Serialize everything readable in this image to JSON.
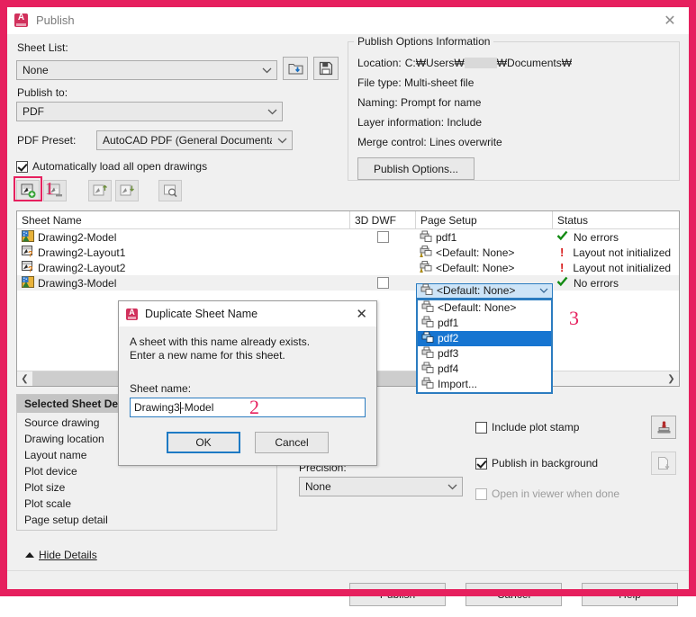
{
  "window": {
    "title": "Publish",
    "logo_text": "A",
    "close_icon": "✕"
  },
  "left": {
    "sheet_list_label": "Sheet List:",
    "sheet_list_value": "None",
    "publish_to_label": "Publish to:",
    "publish_to_value": "PDF",
    "pdf_preset_label": "PDF Preset:",
    "pdf_preset_value": "AutoCAD PDF (General Documentation)",
    "auto_load_label": "Automatically load all open drawings",
    "auto_load_checked": true
  },
  "toolbar": {
    "buttons": [
      "add-sheets-button",
      "remove-sheets-button",
      "move-sheet-up-button",
      "move-sheet-down-button",
      "preview-button"
    ]
  },
  "annotations": {
    "marker1": "1",
    "marker2": "2",
    "marker3": "3",
    "color": "#e6205e"
  },
  "options_info": {
    "legend": "Publish Options Information",
    "location_label": "Location:",
    "location_prefix": "C:₩Users₩",
    "location_suffix": "₩Documents₩",
    "file_type": "File type: Multi-sheet file",
    "naming": "Naming: Prompt for name",
    "layer_information": "Layer information: Include",
    "merge_control": "Merge control: Lines overwrite",
    "publish_options_button": "Publish Options..."
  },
  "sheet_table": {
    "columns": [
      "Sheet Name",
      "3D DWF",
      "Page Setup",
      "Status"
    ],
    "rows": [
      {
        "name": "Drawing2-Model",
        "icon": "model-sheet-icon",
        "dwf": true,
        "page_setup": "pdf1",
        "status": "No errors",
        "status_icon": "check-icon",
        "selected": false
      },
      {
        "name": "Drawing2-Layout1",
        "icon": "layout-sheet-icon",
        "dwf": false,
        "page_setup": "<Default: None>",
        "status": "Layout not initialized",
        "status_icon": "warning-icon",
        "selected": false
      },
      {
        "name": "Drawing2-Layout2",
        "icon": "layout-sheet-icon",
        "dwf": false,
        "page_setup": "<Default: None>",
        "status": "Layout not initialized",
        "status_icon": "warning-icon",
        "selected": false
      },
      {
        "name": "Drawing3-Model",
        "icon": "model-sheet-icon",
        "dwf": true,
        "page_setup": "<Default: None>",
        "status": "No errors",
        "status_icon": "check-icon",
        "selected": true
      }
    ],
    "page_setup_dropdown": {
      "open": true,
      "selected_value": "<Default: None>",
      "highlighted": "pdf2",
      "options": [
        "<Default: None>",
        "pdf1",
        "pdf2",
        "pdf3",
        "pdf4",
        "Import..."
      ]
    },
    "scroll_left_icon": "❮",
    "scroll_right_icon": "❯"
  },
  "details": {
    "header": "Selected Sheet Det",
    "items": [
      "Source drawing",
      "Drawing location",
      "Layout name",
      "Plot device",
      "Plot size",
      "Plot scale",
      "Page setup detail"
    ]
  },
  "middle": {
    "precision_label": "Precision:",
    "precision_value": "None",
    "copies_value": ""
  },
  "right_options": {
    "include_plot_stamp": {
      "label": "Include plot stamp",
      "checked": false,
      "icon": "plot-stamp-icon"
    },
    "publish_in_background": {
      "label": "Publish in background",
      "checked": true,
      "icon": "background-publish-icon"
    },
    "open_in_viewer": {
      "label": "Open in viewer when done",
      "checked": false,
      "disabled": true
    }
  },
  "footer": {
    "hide_details": "Hide Details",
    "publish": "Publish",
    "cancel": "Cancel",
    "help": "Help"
  },
  "modal": {
    "title": "Duplicate Sheet Name",
    "close_icon": "✕",
    "message_line1": "A sheet with this name already exists.",
    "message_line2": "Enter a new name for this sheet.",
    "field_label": "Sheet name:",
    "field_value_before_caret": "Drawing3",
    "field_value_after_caret": "-Model",
    "ok": "OK",
    "cancel": "Cancel"
  }
}
